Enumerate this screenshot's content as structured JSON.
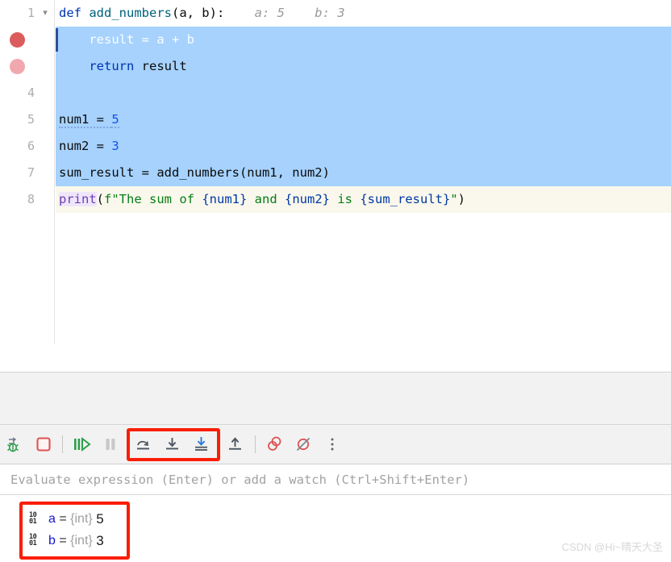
{
  "editor": {
    "lines": [
      {
        "number": "1",
        "gutter": "chevron",
        "state": "normal",
        "segments": [
          {
            "text": "def ",
            "kind": "kw"
          },
          {
            "text": "add_numbers",
            "kind": "fn"
          },
          {
            "text": "(a, b):",
            "kind": "plain"
          }
        ],
        "inline_hints": [
          {
            "text": "a: 5"
          },
          {
            "text": "b: 3"
          }
        ]
      },
      {
        "number": "",
        "gutter": "breakpoint-solid",
        "state": "selected-caret",
        "segments": [
          {
            "text": "    result = a + b",
            "kind": "white"
          }
        ],
        "inline_hints": []
      },
      {
        "number": "",
        "gutter": "breakpoint-muted",
        "state": "selected",
        "segments": [
          {
            "text": "    ",
            "kind": "plain"
          },
          {
            "text": "return",
            "kind": "kw"
          },
          {
            "text": " result",
            "kind": "plain"
          }
        ],
        "inline_hints": []
      },
      {
        "number": "4",
        "gutter": "none",
        "state": "selected",
        "segments": [],
        "inline_hints": []
      },
      {
        "number": "5",
        "gutter": "none",
        "state": "selected",
        "segments": [
          {
            "text": "num1 = ",
            "kind": "plain-squiggle"
          },
          {
            "text": "5",
            "kind": "num-squiggle"
          }
        ],
        "inline_hints": []
      },
      {
        "number": "6",
        "gutter": "none",
        "state": "selected",
        "segments": [
          {
            "text": "num2 = ",
            "kind": "plain"
          },
          {
            "text": "3",
            "kind": "num"
          }
        ],
        "inline_hints": []
      },
      {
        "number": "7",
        "gutter": "none",
        "state": "selected",
        "segments": [
          {
            "text": "sum_result = add_numbers(num1, num2)",
            "kind": "plain"
          }
        ],
        "inline_hints": []
      },
      {
        "number": "8",
        "gutter": "none",
        "state": "exec",
        "segments": [
          {
            "text": "print",
            "kind": "builtin"
          },
          {
            "text": "(",
            "kind": "plain"
          },
          {
            "text": "f\"The sum of ",
            "kind": "str"
          },
          {
            "text": "{num1}",
            "kind": "brace"
          },
          {
            "text": " and ",
            "kind": "str"
          },
          {
            "text": "{num2}",
            "kind": "brace"
          },
          {
            "text": " is ",
            "kind": "str"
          },
          {
            "text": "{sum_result}",
            "kind": "brace"
          },
          {
            "text": "\"",
            "kind": "str"
          },
          {
            "text": ")",
            "kind": "plain"
          }
        ],
        "inline_hints": []
      }
    ]
  },
  "toolbar": {
    "buttons": [
      {
        "name": "rerun-debug-icon",
        "label": "Rerun Debug",
        "icon": "rerun-bug",
        "highlighted": false
      },
      {
        "name": "stop-icon",
        "label": "Stop",
        "icon": "stop",
        "highlighted": false
      },
      {
        "name": "separator-1",
        "label": "",
        "icon": "sep",
        "highlighted": false
      },
      {
        "name": "resume-program-icon",
        "label": "Resume Program",
        "icon": "resume",
        "highlighted": false
      },
      {
        "name": "pause-program-icon",
        "label": "Pause Program",
        "icon": "pause",
        "highlighted": false
      },
      {
        "name": "step-over-icon",
        "label": "Step Over",
        "icon": "step-over",
        "highlighted": true
      },
      {
        "name": "step-into-icon",
        "label": "Step Into",
        "icon": "step-into",
        "highlighted": true
      },
      {
        "name": "force-step-into-icon",
        "label": "Force Step Into",
        "icon": "force-step-into",
        "highlighted": true
      },
      {
        "name": "step-out-icon",
        "label": "Step Out",
        "icon": "step-out",
        "highlighted": false
      },
      {
        "name": "separator-2",
        "label": "",
        "icon": "sep",
        "highlighted": false
      },
      {
        "name": "view-breakpoints-icon",
        "label": "View Breakpoints",
        "icon": "breakpoints",
        "highlighted": false
      },
      {
        "name": "mute-breakpoints-icon",
        "label": "Mute Breakpoints",
        "icon": "mute-breakpoints",
        "highlighted": false
      },
      {
        "name": "more-options-icon",
        "label": "More",
        "icon": "kebab",
        "highlighted": false
      }
    ],
    "highlight_color": "#fa1d05"
  },
  "evaluate": {
    "placeholder": "Evaluate expression (Enter) or add a watch (Ctrl+Shift+Enter)"
  },
  "variables": {
    "rows": [
      {
        "icon": "primitive-type-icon",
        "icon_top": "10",
        "icon_bottom": "01",
        "name": "a",
        "eq": " = ",
        "type": "{int}",
        "value": "5"
      },
      {
        "icon": "primitive-type-icon",
        "icon_top": "10",
        "icon_bottom": "01",
        "name": "b",
        "eq": " = ",
        "type": "{int}",
        "value": "3"
      }
    ],
    "highlight_color": "#fa1d05"
  },
  "watermark": {
    "text": "CSDN @Hi~晴天大圣"
  }
}
